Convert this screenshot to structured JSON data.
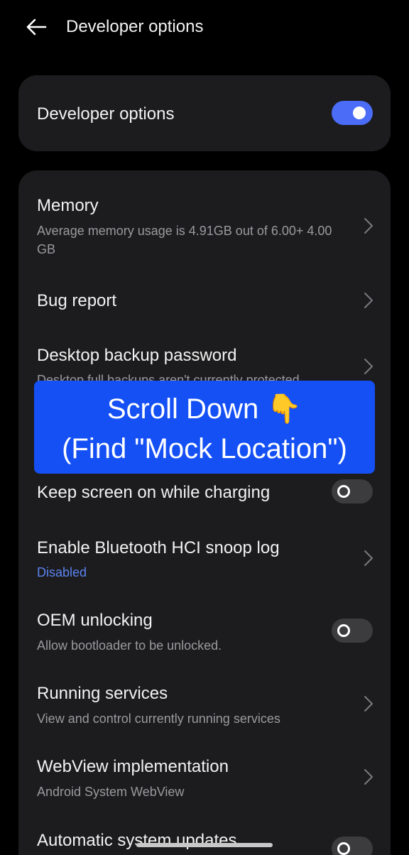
{
  "header": {
    "title": "Developer options",
    "back_icon": "arrow-left-icon"
  },
  "master": {
    "label": "Developer options",
    "enabled": true,
    "accent": "#4a6cf7"
  },
  "settings": [
    {
      "title": "Memory",
      "subtitle": "Average memory usage is 4.91GB out of 6.00+ 4.00 GB",
      "control": "chevron"
    },
    {
      "title": "Bug report",
      "control": "chevron"
    },
    {
      "title": "Desktop backup password",
      "subtitle": "Desktop full backups aren't currently protected",
      "control": "chevron"
    },
    {
      "title": "Keep screen on while charging",
      "control": "toggle",
      "enabled": false
    },
    {
      "title": "Enable Bluetooth HCI snoop log",
      "subtitle": "Disabled",
      "control": "chevron"
    },
    {
      "title": "OEM unlocking",
      "subtitle": "Allow bootloader to be unlocked.",
      "control": "toggle",
      "enabled": false
    },
    {
      "title": "Running services",
      "subtitle": "View and control currently running services",
      "control": "chevron"
    },
    {
      "title": "WebView implementation",
      "subtitle": "Android System WebView",
      "control": "chevron"
    },
    {
      "title": "Automatic system updates",
      "control": "toggle",
      "enabled": false
    }
  ],
  "overlay": {
    "line1": "Scroll Down 👇",
    "line2": "(Find \"Mock Location\")",
    "background": "#1550f5"
  },
  "colors": {
    "background": "#000000",
    "card": "#1c1c1e",
    "link": "#5b82f0"
  }
}
